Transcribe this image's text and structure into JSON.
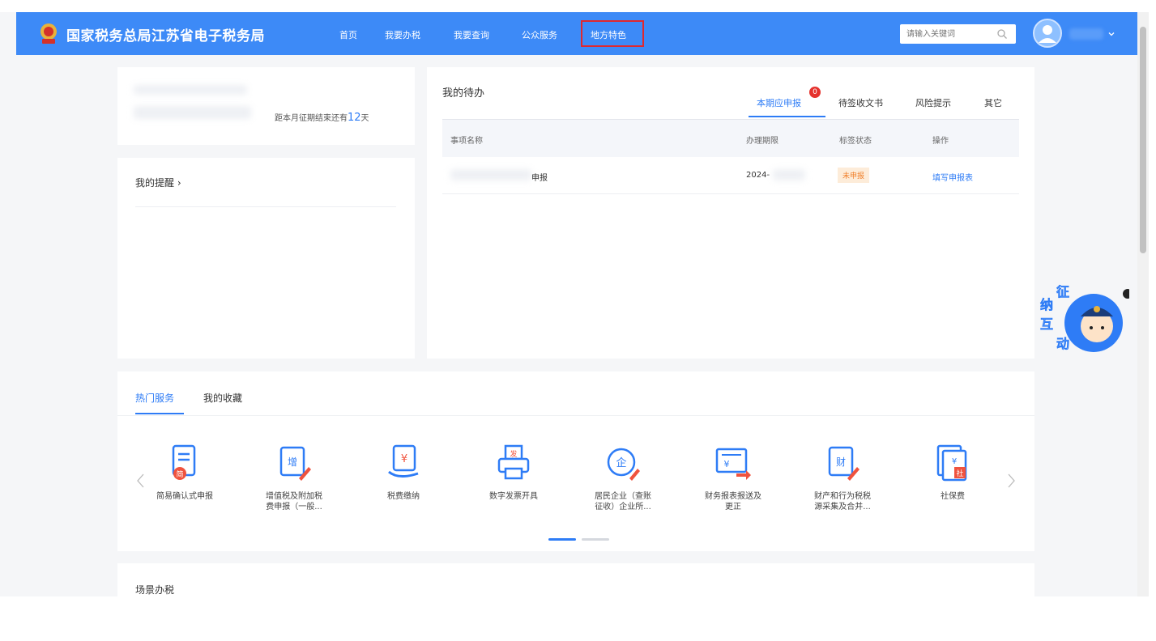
{
  "header": {
    "site_title": "国家税务总局江苏省电子税务局",
    "nav": [
      "首页",
      "我要办税",
      "我要查询",
      "公众服务",
      "地方特色"
    ],
    "search_placeholder": "请输入关键词"
  },
  "info_card": {
    "countdown_prefix": "距本月征期结束还有",
    "countdown_days": "12",
    "countdown_suffix": "天"
  },
  "reminder": {
    "title": "我的提醒 ›"
  },
  "todo": {
    "title": "我的待办",
    "tabs": [
      "本期应申报",
      "待签收文书",
      "风险提示",
      "其它"
    ],
    "tab_badge": "0",
    "columns": [
      "事项名称",
      "办理期限",
      "标签状态",
      "操作"
    ],
    "rows": [
      {
        "name": "申报",
        "deadline": "2024-",
        "status": "未申报",
        "action": "填写申报表"
      }
    ]
  },
  "services": {
    "tabs": [
      "热门服务",
      "我的收藏"
    ],
    "items": [
      {
        "label": "简易确认式申报",
        "icon": "scroll-doc-icon"
      },
      {
        "label": "增值税及附加税\n费申报（一般...",
        "icon": "vat-doc-icon"
      },
      {
        "label": "税费缴纳",
        "icon": "tax-payment-icon"
      },
      {
        "label": "数字发票开具",
        "icon": "invoice-printer-icon"
      },
      {
        "label": "居民企业（查账\n征收）企业所...",
        "icon": "enterprise-tax-icon"
      },
      {
        "label": "财务报表报送及\n更正",
        "icon": "financial-report-icon"
      },
      {
        "label": "财产和行为税税\n源采集及合并...",
        "icon": "property-tax-icon"
      },
      {
        "label": "社保费",
        "icon": "social-security-icon"
      }
    ],
    "page_dots": 2
  },
  "scene": {
    "title": "场景办税"
  },
  "assistant": {
    "label": "征纳互动",
    "chars": [
      "纳",
      "征",
      "互",
      "动"
    ]
  }
}
